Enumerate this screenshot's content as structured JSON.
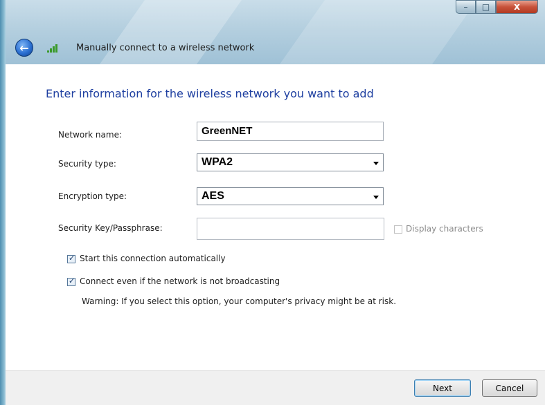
{
  "window": {
    "title": "Manually connect to a wireless network",
    "controls": {
      "minimize": "–",
      "maximize": "□",
      "close": "x"
    }
  },
  "header": {
    "back_icon": "back-arrow-icon",
    "network_icon": "wireless-signal-icon",
    "back_glyph": "←"
  },
  "content": {
    "heading": "Enter information for the wireless network you want to add",
    "network_name": {
      "label": "Network name:",
      "value": "GreenNET"
    },
    "security_type": {
      "label": "Security type:",
      "value": "WPA2"
    },
    "encryption_type": {
      "label": "Encryption type:",
      "value": "AES"
    },
    "passphrase": {
      "label": "Security Key/Passphrase:",
      "value": ""
    },
    "display_characters": {
      "label": "Display characters",
      "checked": false,
      "enabled": false
    },
    "start_automatically": {
      "label": "Start this connection automatically",
      "checked": true
    },
    "connect_not_broadcasting": {
      "label": "Connect even if the network is not broadcasting",
      "checked": true
    },
    "warning": "Warning: If you select this option, your computer's privacy might be at risk."
  },
  "footer": {
    "next_label": "Next",
    "cancel_label": "Cancel"
  },
  "colors": {
    "heading": "#1e3fa0",
    "glass": "#b4cfdf",
    "signal": "#3a9a2a",
    "close_button": "#c8523a"
  }
}
